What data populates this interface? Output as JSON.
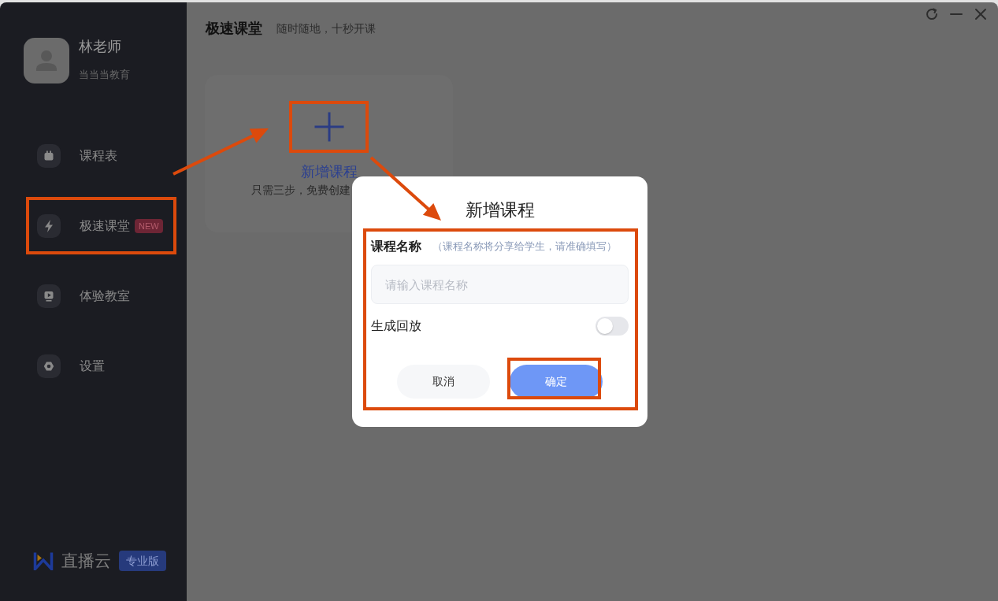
{
  "sidebar": {
    "user": {
      "name": "林老师",
      "organization": "当当当教育"
    },
    "items": [
      {
        "label": "课程表"
      },
      {
        "label": "极速课堂",
        "badge": "NEW"
      },
      {
        "label": "体验教室"
      },
      {
        "label": "设置"
      }
    ],
    "brand": {
      "name": "直播云",
      "edition": "专业版"
    }
  },
  "header": {
    "title": "极速课堂",
    "subtitle": "随时随地，十秒开课"
  },
  "create_card": {
    "title": "新增课程",
    "description": "只需三步，免费创建"
  },
  "dialog": {
    "title": "新增课程",
    "fields": [
      {
        "kind": "text",
        "label": "课程名称",
        "hint": "（课程名称将分享给学生，请准确填写）",
        "placeholder": "请输入课程名称"
      },
      {
        "kind": "toggle",
        "label": "生成回放",
        "on": false
      }
    ],
    "buttons": [
      {
        "kind": "secondary",
        "label": "取消"
      },
      {
        "kind": "primary",
        "label": "确定"
      }
    ]
  }
}
